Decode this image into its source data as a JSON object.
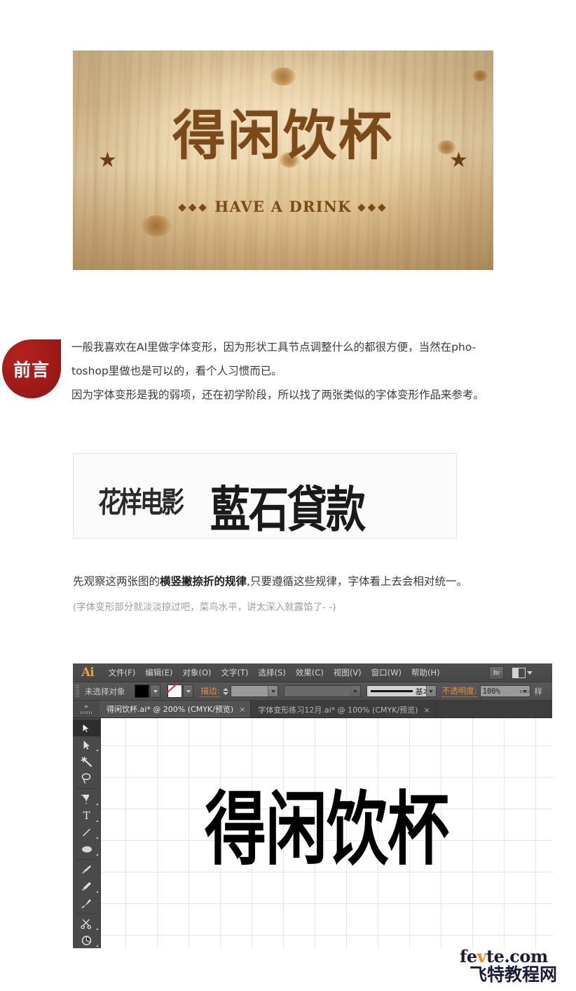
{
  "hero": {
    "carved_title": "得闲饮杯",
    "carved_subtitle_left_diamonds": "◆◆◆",
    "carved_subtitle": "HAVE A DRINK",
    "carved_subtitle_right_diamonds": "◆◆◆",
    "star_left": "★",
    "star_right": "★",
    "wood_base_color": "#e2c89a",
    "carve_color": "#7a4b19"
  },
  "intro": {
    "badge_label": "前言",
    "badge_color": "#a01a18",
    "paragraph1": "一般我喜欢在AI里做字体变形，因为形状工具节点调整什么的都很方便，当然在pho-",
    "paragraph2": "toshop里做也是可以的，看个人习惯而已。",
    "paragraph3": "因为字体变形是我的弱项，还在初学阶段，所以找了两张类似的字体变形作品来参考。"
  },
  "reference": {
    "sample_left": "花样电影",
    "sample_right": "藍石貸款"
  },
  "observe": {
    "line_prefix": "先观察这两张图的",
    "line_bold": "横竖撇捺折的规律",
    "line_suffix": ",只要遵循这些规律，字体看上去会相对统一。",
    "note": "(字体变形部分就淡淡掠过吧，菜鸟水平，讲太深入就露馅了- -)"
  },
  "illustrator": {
    "app_logo": "Ai",
    "menus": [
      "文件(F)",
      "编辑(E)",
      "对象(O)",
      "文字(T)",
      "选择(S)",
      "效果(C)",
      "视图(V)",
      "窗口(W)",
      "帮助(H)"
    ],
    "bridge_button": "Br",
    "control_bar": {
      "selection_status": "未选择对象",
      "fill_color": "#000000",
      "stroke_label": "描边:",
      "stroke_weight_value": "",
      "brush_value": "",
      "profile_value": "基本",
      "opacity_label": "不透明度:",
      "opacity_value": "100%",
      "styles_label": "样"
    },
    "tabs": [
      {
        "title": "得闲饮杯.ai* @ 200% (CMYK/预览)",
        "close": "×",
        "active": true
      },
      {
        "title": "字体变形练习12月.ai* @ 100% (CMYK/预览)",
        "close": "×",
        "active": false
      }
    ],
    "tools": [
      {
        "name": "selection-tool",
        "glyph": "selection",
        "selected": true,
        "corner": false
      },
      {
        "name": "direct-selection-tool",
        "glyph": "direct",
        "selected": false,
        "corner": true
      },
      {
        "name": "magic-wand-tool",
        "glyph": "wand",
        "selected": false,
        "corner": false
      },
      {
        "name": "lasso-tool",
        "glyph": "lasso",
        "selected": false,
        "corner": false
      },
      {
        "name": "pen-tool",
        "glyph": "pen",
        "selected": false,
        "corner": true
      },
      {
        "name": "type-tool",
        "glyph": "type",
        "selected": false,
        "corner": true
      },
      {
        "name": "line-segment-tool",
        "glyph": "line",
        "selected": false,
        "corner": true
      },
      {
        "name": "ellipse-tool",
        "glyph": "ellipse",
        "selected": false,
        "corner": true
      },
      {
        "name": "paintbrush-tool",
        "glyph": "brush",
        "selected": false,
        "corner": false
      },
      {
        "name": "pencil-tool",
        "glyph": "pencil",
        "selected": false,
        "corner": true
      },
      {
        "name": "blob-brush-tool",
        "glyph": "blob",
        "selected": false,
        "corner": false
      },
      {
        "name": "scissors-tool",
        "glyph": "scissors",
        "selected": false,
        "corner": true
      },
      {
        "name": "rotate-tool",
        "glyph": "rotate",
        "selected": false,
        "corner": true
      }
    ],
    "canvas_artwork": "得闲饮杯"
  },
  "footer": {
    "site_part1": "fe",
    "site_part2": "v",
    "site_part3": "te.com",
    "site_cn": "飞特教程网",
    "accent_color": "#f18a1c",
    "text_color": "#1b1b3a"
  }
}
